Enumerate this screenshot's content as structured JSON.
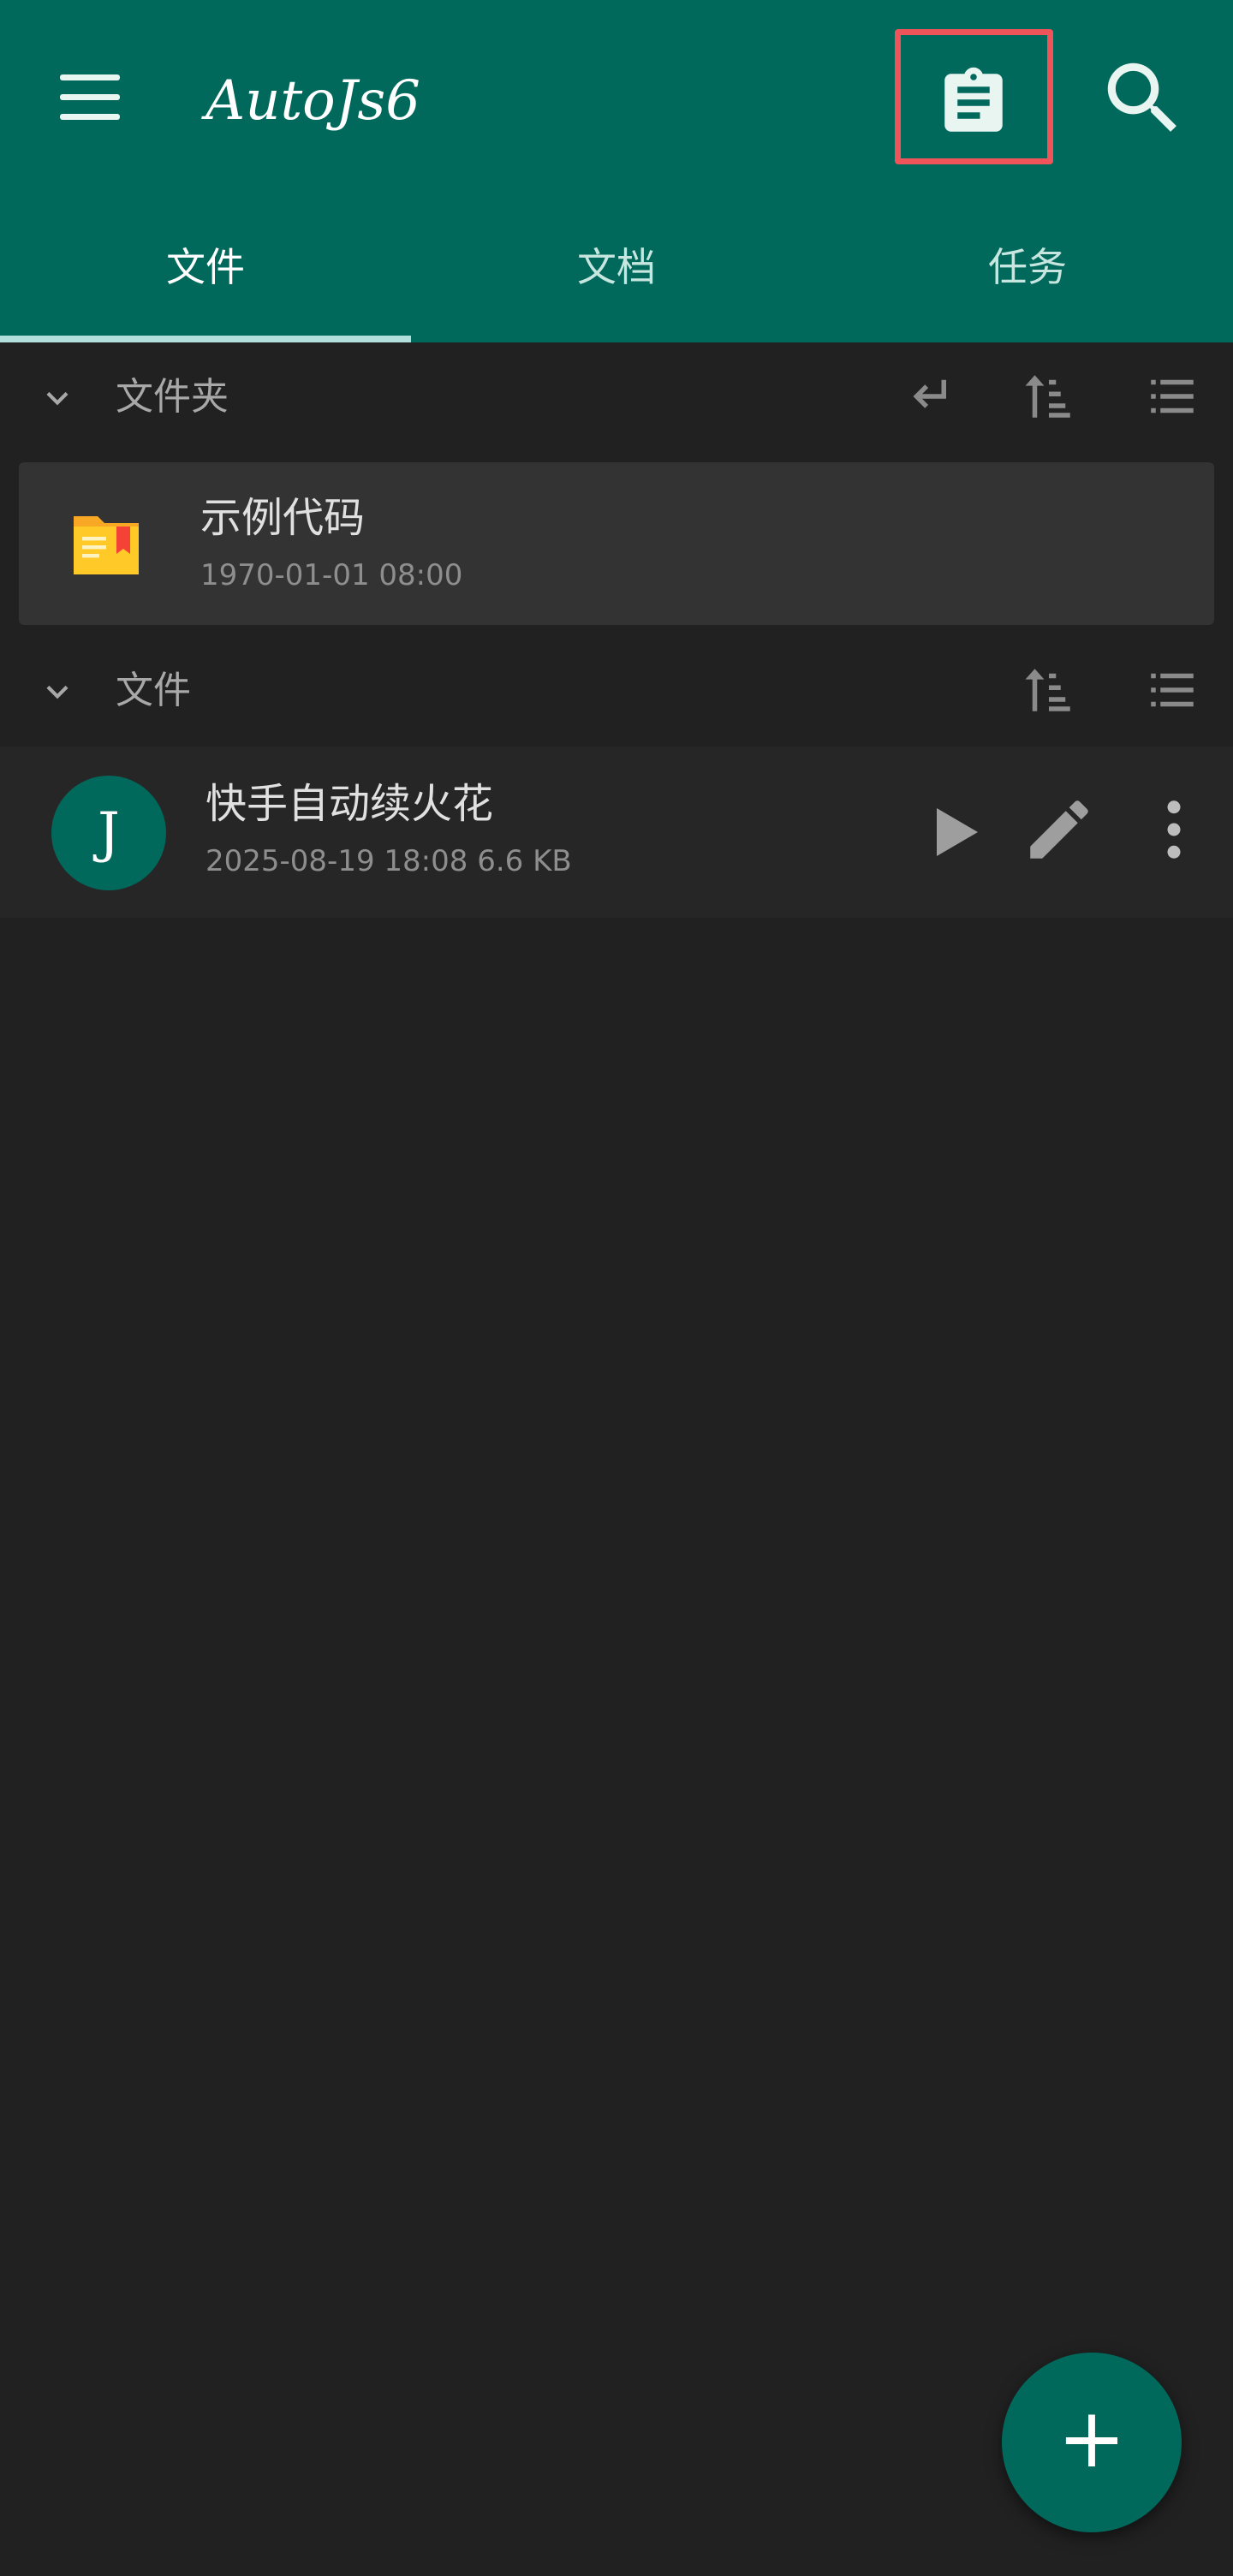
{
  "appbar": {
    "title": "AutoJs6",
    "menu_icon": "menu-icon",
    "clipboard_icon": "clipboard-icon",
    "search_icon": "search-icon",
    "background": "#00695C",
    "highlight_color": "#F0545B"
  },
  "tabs": [
    {
      "label": "文件",
      "active": true
    },
    {
      "label": "文档",
      "active": false
    },
    {
      "label": "任务",
      "active": false
    }
  ],
  "folders_section": {
    "label": "文件夹",
    "icons": [
      "go-up-icon",
      "sort-icon",
      "list-view-icon"
    ],
    "items": [
      {
        "name": "示例代码",
        "date": "1970-01-01 08:00",
        "icon": "folder-icon"
      }
    ]
  },
  "files_section": {
    "label": "文件",
    "icons": [
      "sort-icon",
      "list-view-icon"
    ],
    "items": [
      {
        "avatar_letter": "J",
        "name": "快手自动续火花",
        "meta": "2025-08-19 18:08  6.6 KB",
        "actions": [
          "play-icon",
          "edit-icon",
          "more-vert-icon"
        ]
      }
    ]
  },
  "fab": {
    "label": "+",
    "icon": "add-icon"
  }
}
